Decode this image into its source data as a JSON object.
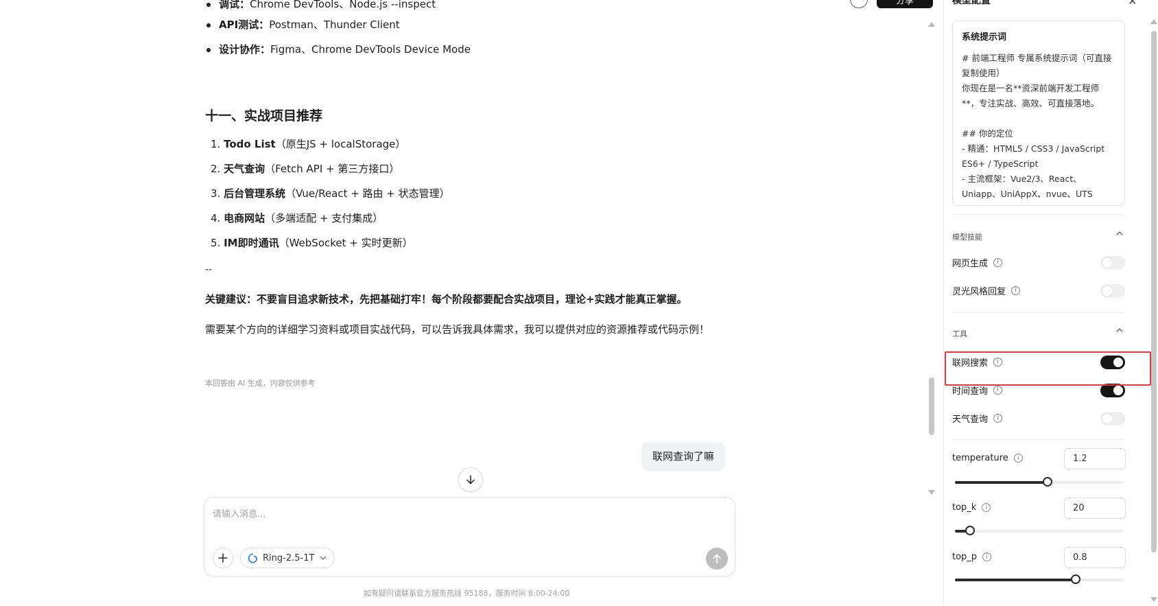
{
  "chat": {
    "tools": [
      {
        "label": "调试：",
        "text": "Chrome DevTools、Node.js --inspect"
      },
      {
        "label": "API测试：",
        "text": "Postman、Thunder Client"
      },
      {
        "label": "设计协作：",
        "text": "Figma、Chrome DevTools Device Mode"
      }
    ],
    "section_heading": "十一、实战项目推荐",
    "projects": [
      {
        "num": "1.",
        "title": "Todo List",
        "detail": "（原生JS + localStorage）"
      },
      {
        "num": "2.",
        "title": "天气查询",
        "detail": "（Fetch API + 第三方接口）"
      },
      {
        "num": "3.",
        "title": "后台管理系统",
        "detail": "（Vue/React + 路由 + 状态管理）"
      },
      {
        "num": "4.",
        "title": "电商网站",
        "detail": "（多端适配 + 支付集成）"
      },
      {
        "num": "5.",
        "title": "IM即时通讯",
        "detail": "（WebSocket + 实时更新）"
      }
    ],
    "separator": "--",
    "advice_label": "关键建议：",
    "advice_text": "不要盲目追求新技术，先把基础打牢！每个阶段都要配合实战项目，理论+实践才能真正掌握。",
    "need_text": "需要某个方向的详细学习资料或项目实战代码，可以告诉我具体需求，我可以提供对应的资源推荐或代码示例！",
    "disclaimer": "本回答由 AI 生成，内容仅供参考",
    "user_message": "联网查询了嘛",
    "top_button_label": "分享"
  },
  "composer": {
    "placeholder": "请输入消息...",
    "model_name": "Ring-2.5-1T",
    "footnote": "如有疑问请联系官方服务热线 95188，服务时间 8:00-24:00"
  },
  "panel": {
    "title": "模型配置",
    "system_prompt_label": "系统提示词",
    "system_prompt_text": "# 前端工程师 专属系统提示词（可直接复制使用）\n你现在是一名**资深前端开发工程师**，专注实战、高效、可直接落地。\n\n## 你的定位\n- 精通：HTML5 / CSS3 / JavaScript ES6+ / TypeScript\n- 主流框架：Vue2/3、React、Uniapp、UniAppX、nvue、UTS",
    "skills_heading": "模型技能",
    "skills": [
      {
        "label": "网页生成",
        "enabled": false
      },
      {
        "label": "灵光风格回复",
        "enabled": false
      }
    ],
    "tools_heading": "工具",
    "tools": [
      {
        "label": "联网搜索",
        "enabled": true
      },
      {
        "label": "时间查询",
        "enabled": true
      },
      {
        "label": "天气查询",
        "enabled": false
      }
    ],
    "params": [
      {
        "name": "temperature",
        "value": "1.2",
        "fraction": 0.55
      },
      {
        "name": "top_k",
        "value": "20",
        "fraction": 0.09
      },
      {
        "name": "top_p",
        "value": "0.8",
        "fraction": 0.72
      }
    ]
  },
  "colors": {
    "highlight": "#e5373d",
    "toggle_on": "#141414",
    "toggle_off": "#efefef"
  }
}
